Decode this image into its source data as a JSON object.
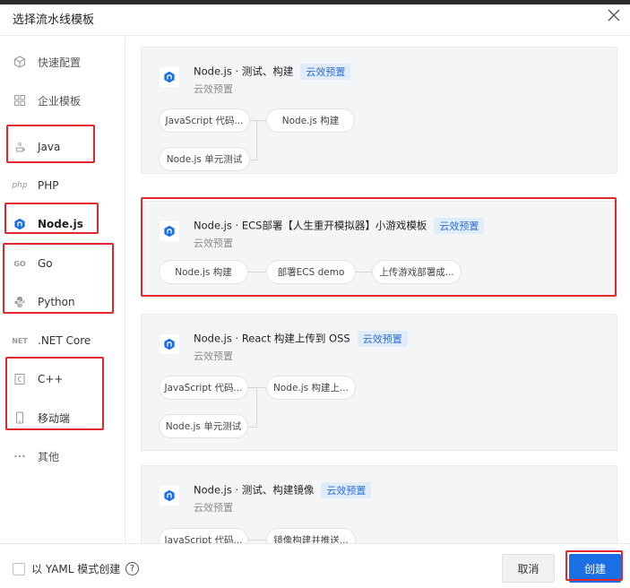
{
  "dialog": {
    "title": "选择流水线模板"
  },
  "sidebar": {
    "items": [
      {
        "label": "快速配置"
      },
      {
        "label": "企业模板"
      },
      {
        "label": "Java"
      },
      {
        "label": "PHP",
        "icon_text": "php"
      },
      {
        "label": "Node.js"
      },
      {
        "label": "Go",
        "icon_text": "GO"
      },
      {
        "label": "Python"
      },
      {
        "label": ".NET Core",
        "icon_text": "NET"
      },
      {
        "label": "C++"
      },
      {
        "label": "移动端"
      },
      {
        "label": "其他"
      }
    ]
  },
  "cards": [
    {
      "title": "Node.js · 测试、构建",
      "badge": "云效预置",
      "subtitle": "云效预置",
      "steps": [
        "JavaScript 代码...",
        "Node.js 构建",
        "Node.js 单元测试"
      ]
    },
    {
      "title": "Node.js · ECS部署【人生重开模拟器】小游戏模板",
      "badge": "云效预置",
      "subtitle": "云效预置",
      "steps": [
        "Node.js 构建",
        "部署ECS demo",
        "上传游戏部署成..."
      ]
    },
    {
      "title": "Node.js · React 构建上传到 OSS",
      "badge": "云效预置",
      "subtitle": "云效预置",
      "steps": [
        "JavaScript 代码...",
        "Node.js 构建上...",
        "Node.js 单元测试"
      ]
    },
    {
      "title": "Node.js · 测试、构建镜像",
      "badge": "云效预置",
      "subtitle": "云效预置",
      "steps": [
        "JavaScript 代码...",
        "镜像构建并推送..."
      ]
    }
  ],
  "footer": {
    "yaml_label": "以 YAML 模式创建",
    "help_symbol": "?",
    "cancel_label": "取消",
    "create_label": "创建"
  },
  "colors": {
    "accent": "#1b6fe4",
    "highlight": "#e0282e",
    "badge_bg": "#e1ecfb",
    "badge_text": "#2d6ed8"
  }
}
